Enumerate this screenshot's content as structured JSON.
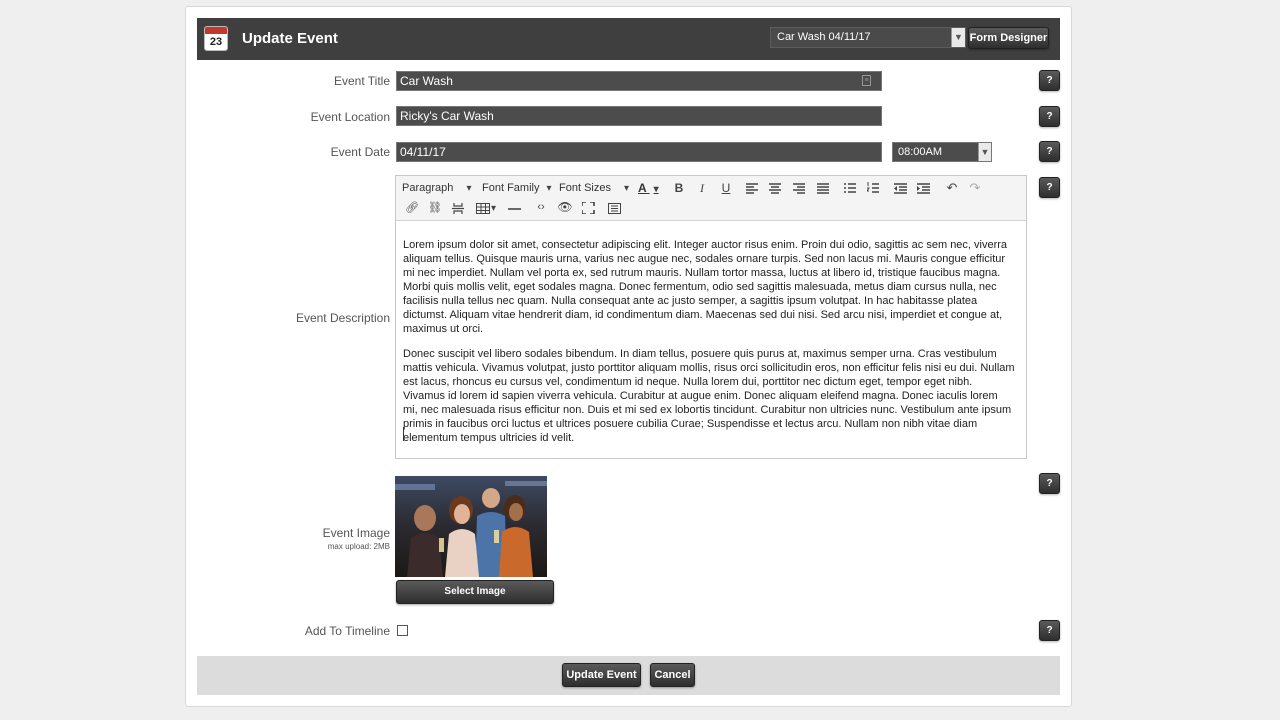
{
  "header": {
    "title": "Update Event",
    "calendar_icon": "calendar-icon",
    "calendar_day": "23",
    "event_select_value": "Car Wash 04/11/17",
    "form_designer_label": "Form Designer"
  },
  "form": {
    "title": {
      "label": "Event Title",
      "value": "Car Wash"
    },
    "location": {
      "label": "Event Location",
      "value": "Ricky's Car Wash"
    },
    "date": {
      "label": "Event Date",
      "value": "04/11/17",
      "time_value": "08:00AM"
    },
    "description": {
      "label": "Event Description",
      "toolbar": {
        "paragraph": "Paragraph",
        "font_family": "Font Family",
        "font_sizes": "Font Sizes",
        "text_color_glyph": "A",
        "bold_glyph": "B",
        "italic_glyph": "I",
        "underline_glyph": "U"
      },
      "paragraphs": [
        "Lorem ipsum dolor sit amet, consectetur adipiscing elit. Integer auctor risus enim. Proin dui odio, sagittis ac sem nec, viverra aliquam tellus. Quisque mauris urna, varius nec augue nec, sodales ornare turpis. Sed non lacus mi. Mauris congue efficitur mi nec imperdiet. Nullam vel porta ex, sed rutrum mauris. Nullam tortor massa, luctus at libero id, tristique faucibus magna. Morbi quis mollis velit, eget sodales magna. Donec fermentum, odio sed sagittis malesuada, metus diam cursus nulla, nec facilisis nulla tellus nec quam. Nulla consequat ante ac justo semper, a sagittis ipsum volutpat. In hac habitasse platea dictumst. Aliquam vitae hendrerit diam, id condimentum diam. Maecenas sed dui nisi. Sed arcu nisi, imperdiet et congue at, maximus ut orci.",
        "Donec suscipit vel libero sodales bibendum. In diam tellus, posuere quis purus at, maximus semper urna. Cras vestibulum mattis vehicula. Vivamus volutpat, justo porttitor aliquam mollis, risus orci sollicitudin eros, non efficitur felis nisi eu dui. Nullam est lacus, rhoncus eu cursus vel, condimentum id neque. Nulla lorem dui, porttitor nec dictum eget, tempor eget nibh. Vivamus id lorem id sapien viverra vehicula. Curabitur at augue enim. Donec aliquam eleifend magna. Donec iaculis lorem mi, nec malesuada risus efficitur non. Duis et mi sed ex lobortis tincidunt. Curabitur non ultricies nunc. Vestibulum ante ipsum primis in faucibus orci luctus et ultrices posuere cubilia Curae; Suspendisse et lectus arcu. Nullam non nibh vitae diam elementum tempus ultricies id velit."
      ]
    },
    "image": {
      "label": "Event Image",
      "sub_label": "max upload: 2MB",
      "select_label": "Select Image"
    },
    "timeline": {
      "label": "Add To Timeline",
      "checked": false
    },
    "help_label": "?"
  },
  "footer": {
    "update_label": "Update Event",
    "cancel_label": "Cancel"
  },
  "colors": {
    "header_bg": "#3f3f3f",
    "input_bg": "#4c4c4c",
    "footer_bg": "#dcdcdc",
    "page_bg": "#efefef"
  }
}
